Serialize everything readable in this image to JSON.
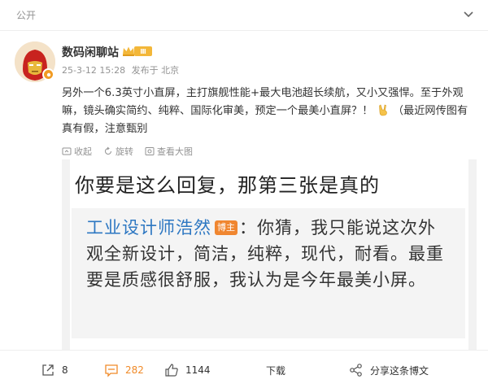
{
  "header": {
    "visibility": "公开"
  },
  "author": {
    "name": "数码闲聊站",
    "level": "Ⅲ",
    "timestamp": "25-3-12 15:28",
    "source": "发布于 北京"
  },
  "post": {
    "text_before_emoji": "另外一个6.3英寸小直屏，主打旗舰性能+最大电池超长续航，又小又强悍。至于外观嘛，镜头确实简约、纯粹、国际化审美，预定一个最美小直屏？！",
    "emoji": "victory-hand",
    "text_after_emoji": "（最近网传图有真有假，注意甄别"
  },
  "image_actions": {
    "collect": "收起",
    "rotate": "旋转",
    "view_large": "查看大图"
  },
  "screenshot": {
    "title": "你要是这么回复，那第三张是真的",
    "quote_author": "工业设计师浩然",
    "quote_tag": "博主",
    "quote_body": "：你猜，我只能说这次外观全新设计，简洁，纯粹，现代，耐看。最重要是质感很舒服，我认为是今年最美小屏。"
  },
  "footer": {
    "repost_count": "8",
    "comment_count": "282",
    "like_count": "1144",
    "download_label": "下载",
    "share_label": "分享这条博文"
  },
  "colors": {
    "accent_orange": "#f08a28",
    "link_blue": "#2d77c2",
    "muted": "#939393"
  }
}
